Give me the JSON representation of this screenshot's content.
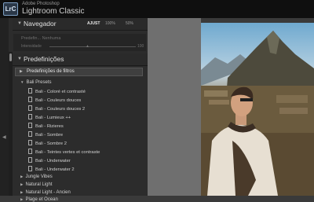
{
  "app": {
    "vendor": "Adobe Photoshop",
    "name": "Lightroom Classic",
    "logo_text": "LrC"
  },
  "navigator": {
    "title": "Navegador",
    "zoom": [
      {
        "label": "AJUST",
        "active": true
      },
      {
        "label": "100%",
        "active": false
      },
      {
        "label": "50%",
        "active": false
      }
    ]
  },
  "preview": {
    "text": "Predefin... Nenhuma",
    "intensity_label": "Intensidade",
    "intensity_value": "100"
  },
  "presets": {
    "title": "Predefinições",
    "group_label": "Predefinições de filtros",
    "folder_open": "Bali Presets",
    "items": [
      "Bali - Coloré et contrasté",
      "Bali - Couleurs douces",
      "Bali - Couleurs douces 2",
      "Bali - Lumieux ++",
      "Bali - Rizieres",
      "Bali - Sombre",
      "Bali - Sombre 2",
      "Bali - Teintes vertes et contraste",
      "Bali - Underwater",
      "Bali - Underwater 2"
    ],
    "folders": [
      "Jungle Vibes",
      "Natural Light",
      "Natural Light - Ancien",
      "Plage et Ocean"
    ]
  },
  "icons": [
    "lightroom-logo",
    "collapse-left-arrow",
    "disclosure-triangle",
    "preset-file-icon"
  ]
}
